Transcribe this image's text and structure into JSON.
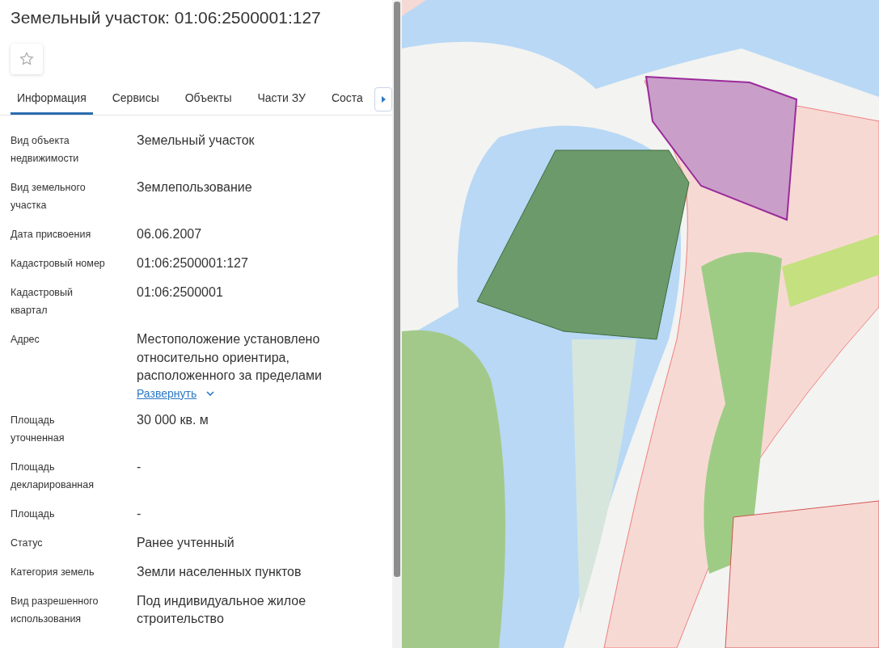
{
  "title": "Земельный участок: 01:06:2500001:127",
  "favorite": {
    "selected": false
  },
  "tabs": [
    {
      "label": "Информация",
      "selected": true
    },
    {
      "label": "Сервисы",
      "selected": false
    },
    {
      "label": "Объекты",
      "selected": false
    },
    {
      "label": "Части ЗУ",
      "selected": false
    },
    {
      "label": "Соста",
      "selected": false
    }
  ],
  "fields": [
    {
      "kind": "text",
      "label": "Вид объекта недвижимости",
      "value": "Земельный участок"
    },
    {
      "kind": "text",
      "label": "Вид земельного участка",
      "value": "Землепользование"
    },
    {
      "kind": "text",
      "label": "Дата присвоения",
      "value": "06.06.2007"
    },
    {
      "kind": "text",
      "label": "Кадастровый номер",
      "value": "01:06:2500001:127"
    },
    {
      "kind": "text",
      "label": "Кадастровый квартал",
      "value": "01:06:2500001"
    },
    {
      "kind": "expandable",
      "label": "Адрес",
      "lines": [
        "Местоположение установлено",
        "относительно ориентира,",
        "расположенного за пределами"
      ],
      "link": "Развернуть"
    },
    {
      "kind": "text",
      "label": "Площадь уточненная",
      "value": "30 000 кв. м"
    },
    {
      "kind": "text",
      "label": "Площадь декларированная",
      "value": "-"
    },
    {
      "kind": "text",
      "label": "Площадь",
      "value": "-"
    },
    {
      "kind": "text",
      "label": "Статус",
      "value": "Ранее учтенный"
    },
    {
      "kind": "text",
      "label": "Категория земель",
      "value": "Земли населенных пунктов"
    },
    {
      "kind": "text",
      "label": "Вид разрешенного использования",
      "value": "Под индивидуальное жилое строительство"
    }
  ]
}
